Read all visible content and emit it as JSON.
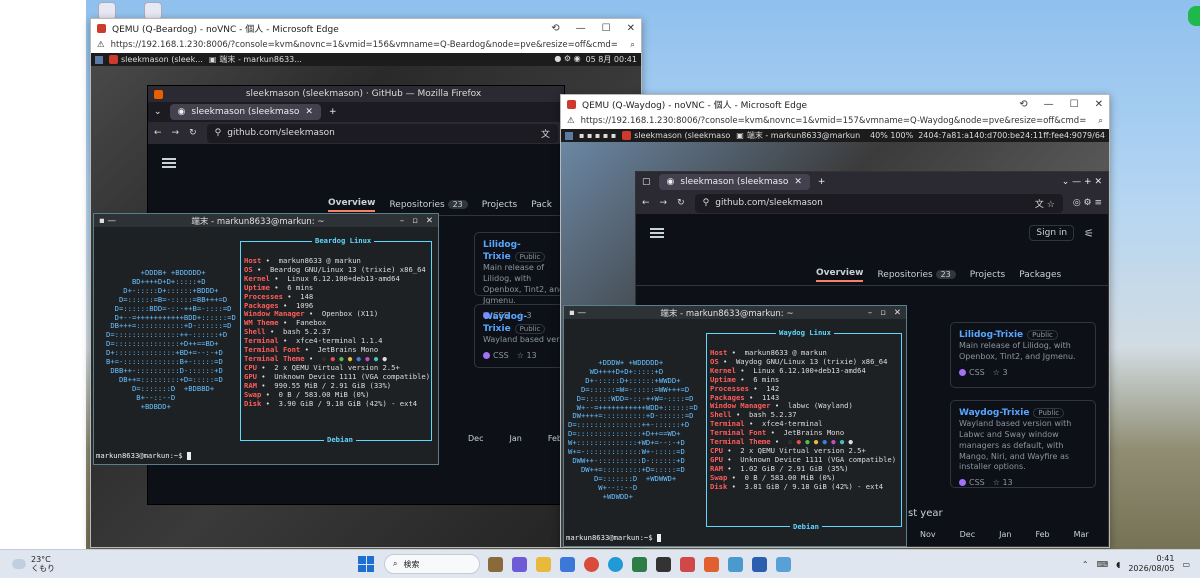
{
  "taskbar": {
    "temp": "23°C",
    "weather_desc": "くもり",
    "search_label": "検索",
    "time": "0:41",
    "date": "2026/08/05"
  },
  "edge_left": {
    "title": "QEMU (Q-Beardog) - noVNC - 個人 - Microsoft Edge",
    "url": "https://192.168.1.230:8006/?console=kvm&novnc=1&vmid=156&vmname=Q-Beardog&node=pve&resize=off&cmd=",
    "panel": {
      "tasks": [
        "sleekmason (sleek...",
        "端末 - markun8633..."
      ],
      "clock": "05 8月 00:41"
    }
  },
  "edge_right": {
    "title": "QEMU (Q-Waydog) - noVNC - 個人 - Microsoft Edge",
    "url": "https://192.168.1.230:8006/?console=kvm&novnc=1&vmid=157&vmname=Q-Waydog&node=pve&resize=off&cmd=",
    "panel": {
      "tasks": [
        "sleekmason (sleekmaso",
        "端末 - markun8633@markun"
      ],
      "stats": "40%  100%",
      "ip": "2404:7a81:a140:d700:be24:11ff:fee4:9079/64"
    }
  },
  "firefox": {
    "title": "sleekmason (sleekmason) · GitHub — Mozilla Firefox",
    "tab": "sleekmason (sleekmaso",
    "url": "github.com/sleekmason"
  },
  "browser2": {
    "tab": "sleekmason (sleekmaso",
    "url": "github.com/sleekmason",
    "signin": "Sign in"
  },
  "github": {
    "tabs": {
      "overview": "Overview",
      "repositories": "Repositories",
      "repo_count": "23",
      "projects": "Projects",
      "packages": "Packages",
      "packages_short": "Pack"
    },
    "cards": [
      {
        "name": "Lilidog-Trixie",
        "badge": "Public",
        "desc": "Main release of Lilidog, with Openbox, Tint2, and Jgmenu.",
        "lang": "CSS",
        "stars": "3"
      },
      {
        "name": "Waydog-Trixie",
        "badge": "Public",
        "desc": "Wayland based version with Labwc and Sway window managers as default, with Mango, Niri, and Wayfire as installer options.",
        "lang": "CSS",
        "stars": "13"
      }
    ],
    "months_left": [
      "Dec",
      "Jan",
      "Feb"
    ],
    "months_right": [
      "Nov",
      "Dec",
      "Jan",
      "Feb",
      "Mar"
    ],
    "contrib_tail": "st year"
  },
  "term_left": {
    "title": "端末 - markun8633@markun: ~",
    "header": "Beardog Linux",
    "footer": "Debian",
    "prompt": "markun8633@markun:~$ ",
    "rows": [
      {
        "k": "Host",
        "v": "markun8633 @ markun"
      },
      {
        "k": "OS",
        "v": "Beardog GNU/Linux 13 (trixie) x86_64"
      },
      {
        "k": "Kernel",
        "v": "Linux 6.12.100+deb13-amd64"
      },
      {
        "k": "Uptime",
        "v": "6 mins"
      },
      {
        "k": "Processes",
        "v": "148"
      },
      {
        "k": "Packages",
        "v": "1096"
      },
      {
        "k": "Window Manager",
        "v": "Openbox (X11)"
      },
      {
        "k": "WM Theme",
        "v": "Fanebox"
      },
      {
        "k": "Shell",
        "v": "bash 5.2.37"
      },
      {
        "k": "Terminal",
        "v": "xfce4-terminal 1.1.4"
      },
      {
        "k": "Terminal Font",
        "v": "JetBrains Mono"
      },
      {
        "k": "Terminal Theme",
        "v": "● ● ● ● ● ● ● ●"
      },
      {
        "k": "CPU",
        "v": "2 x QEMU Virtual version 2.5+"
      },
      {
        "k": "GPU",
        "v": "Unknown Device 1111 (VGA compatible)"
      },
      {
        "k": "RAM",
        "v": "990.55 MiB / 2.91 GiB (33%)"
      },
      {
        "k": "Swap",
        "v": "0 B / 583.00 MiB (0%)"
      },
      {
        "k": "Disk",
        "v": "3.90 GiB / 9.18 GiB (42%) - ext4"
      }
    ],
    "ascii": "        +DDDB+ +BDDDDD+\n      BD++++D+D+:::::+D\n    D+-:::::D+::::::+BDDD+\n   D=::::::=B=-:::::=BB+++=D\n  D=::::::BDD=-::-++B=-::::=D\n  D+--=+++++++++++BDD+::::::=D\n DB+++=:::::::::::+D-::::::=D\nD=:::::::::::::::++-::::::+D\nD=:::::::::::::::+D++==BD+\nD+::::::::::::::+BD+=--:-+D\nB+=-:::::::::::::B+-:::::=D\n DBB++-::::::::::D-::::::+D\n   DB++=:::::::::+D=:::::=D\n      D=:::::::D  +BDBBD+\n       B+--::--D\n        +BDBDD+"
  },
  "term_right": {
    "title": "端末 - markun8633@markun: ~",
    "header": "Waydog Linux",
    "footer": "Debian",
    "prompt": "markun8633@markun:~$ ",
    "rows": [
      {
        "k": "Host",
        "v": "markun8633 @ markun"
      },
      {
        "k": "OS",
        "v": "Waydog GNU/Linux 13 (trixie) x86_64"
      },
      {
        "k": "Kernel",
        "v": "Linux 6.12.100+deb13-amd64"
      },
      {
        "k": "Uptime",
        "v": "6 mins"
      },
      {
        "k": "Processes",
        "v": "142"
      },
      {
        "k": "Packages",
        "v": "1143"
      },
      {
        "k": "Window Manager",
        "v": "labwc (Wayland)"
      },
      {
        "k": "Shell",
        "v": "bash 5.2.37"
      },
      {
        "k": "Terminal",
        "v": "xfce4-terminal"
      },
      {
        "k": "Terminal Font",
        "v": "JetBrains Mono"
      },
      {
        "k": "Terminal Theme",
        "v": "● ● ● ● ● ● ● ●"
      },
      {
        "k": "CPU",
        "v": "2 x QEMU Virtual version 2.5+"
      },
      {
        "k": "GPU",
        "v": "Unknown Device 1111 (VGA compatible)"
      },
      {
        "k": "RAM",
        "v": "1.02 GiB / 2.91 GiB (35%)"
      },
      {
        "k": "Swap",
        "v": "0 B / 583.00 MiB (0%)"
      },
      {
        "k": "Disk",
        "v": "3.81 GiB / 9.18 GiB (42%) - ext4"
      }
    ],
    "ascii": "       +DDDW+ +WDDDDD+\n     WD++++D+D+:::::+D\n    D+-:::::D+::::::+WWDD+\n   D=::::::=W=-:::::=WW+++=D\n  D=::::::WDD=-::-++W=-::::=D\n  W+--=+++++++++++WDD+::::::=D\n DW++++=::::::::::+D-::::::=D\nD=:::::::::::::::++-::::::+D\nD=:::::::::::::::+D++==WD+\nW+::::::::::::::+WD+=--:-+D\nW+=-:::::::::::::W+-:::::=D\n DWW++-::::::::::D-::::::+D\n   DW++=:::::::::+D=:::::=D\n      D=:::::::D  +WDWWD+\n       W+--::--D\n        +WDWDD+"
  }
}
